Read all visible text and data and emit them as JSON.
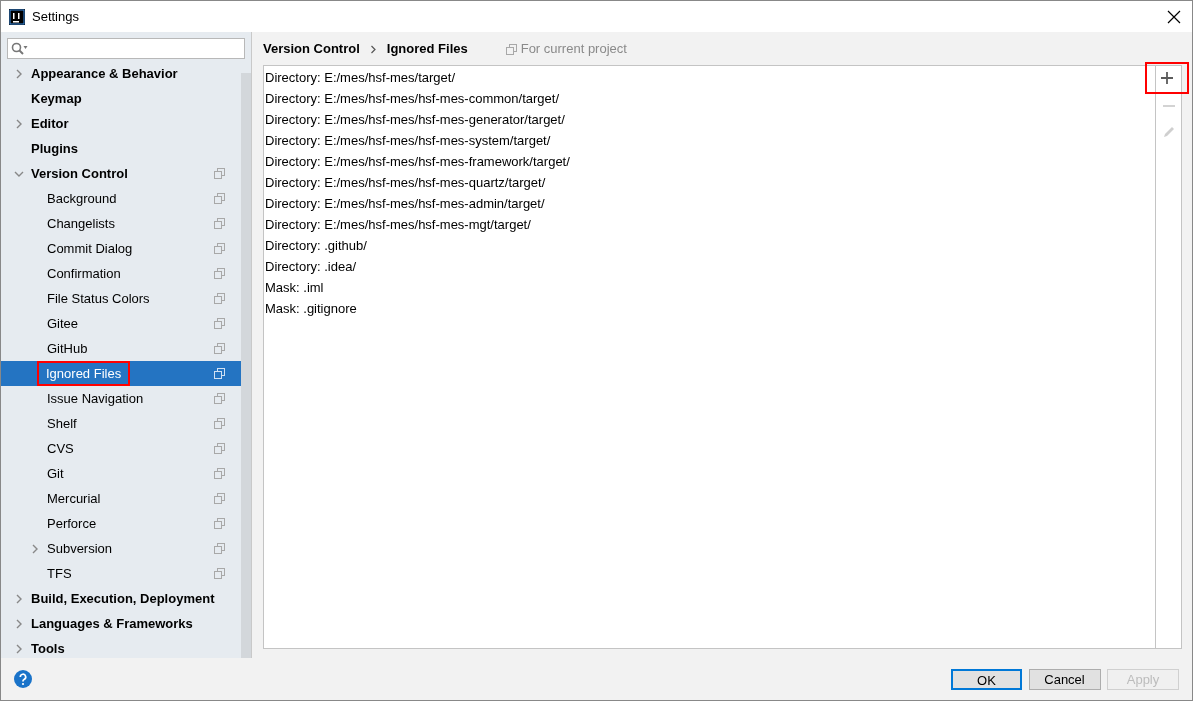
{
  "window": {
    "title": "Settings"
  },
  "sidebar": {
    "items": [
      {
        "label": "Appearance & Behavior",
        "expanded": false,
        "project_level": false,
        "selected": false,
        "annotated": false
      },
      {
        "label": "Keymap",
        "project_level": false,
        "selected": false,
        "annotated": false
      },
      {
        "label": "Editor",
        "expanded": false,
        "project_level": false,
        "selected": false,
        "annotated": false
      },
      {
        "label": "Plugins",
        "project_level": false,
        "selected": false,
        "annotated": false
      },
      {
        "label": "Version Control",
        "expanded": true,
        "project_level": true,
        "selected": false,
        "annotated": false,
        "children": [
          {
            "label": "Background",
            "project_level": true,
            "selected": false,
            "annotated": false
          },
          {
            "label": "Changelists",
            "project_level": true,
            "selected": false,
            "annotated": false
          },
          {
            "label": "Commit Dialog",
            "project_level": true,
            "selected": false,
            "annotated": false
          },
          {
            "label": "Confirmation",
            "project_level": true,
            "selected": false,
            "annotated": false
          },
          {
            "label": "File Status Colors",
            "project_level": true,
            "selected": false,
            "annotated": false
          },
          {
            "label": "Gitee",
            "project_level": true,
            "selected": false,
            "annotated": false
          },
          {
            "label": "GitHub",
            "project_level": true,
            "selected": false,
            "annotated": false
          },
          {
            "label": "Ignored Files",
            "project_level": true,
            "selected": true,
            "annotated": true
          },
          {
            "label": "Issue Navigation",
            "project_level": true,
            "selected": false,
            "annotated": false
          },
          {
            "label": "Shelf",
            "project_level": true,
            "selected": false,
            "annotated": false
          },
          {
            "label": "CVS",
            "project_level": true,
            "selected": false,
            "annotated": false
          },
          {
            "label": "Git",
            "project_level": true,
            "selected": false,
            "annotated": false
          },
          {
            "label": "Mercurial",
            "project_level": true,
            "selected": false,
            "annotated": false
          },
          {
            "label": "Perforce",
            "project_level": true,
            "selected": false,
            "annotated": false
          },
          {
            "label": "Subversion",
            "expanded": false,
            "project_level": true,
            "selected": false,
            "annotated": false
          },
          {
            "label": "TFS",
            "project_level": true,
            "selected": false,
            "annotated": false
          }
        ]
      },
      {
        "label": "Build, Execution, Deployment",
        "expanded": false,
        "project_level": false,
        "selected": false,
        "annotated": false
      },
      {
        "label": "Languages & Frameworks",
        "expanded": false,
        "project_level": false,
        "selected": false,
        "annotated": false
      },
      {
        "label": "Tools",
        "expanded": false,
        "project_level": false,
        "selected": false,
        "annotated": false
      }
    ]
  },
  "breadcrumb": [
    "Version Control",
    "Ignored Files"
  ],
  "scope_note": "For current project",
  "ignored_files": [
    "Directory: E:/mes/hsf-mes/target/",
    "Directory: E:/mes/hsf-mes/hsf-mes-common/target/",
    "Directory: E:/mes/hsf-mes/hsf-mes-generator/target/",
    "Directory: E:/mes/hsf-mes/hsf-mes-system/target/",
    "Directory: E:/mes/hsf-mes/hsf-mes-framework/target/",
    "Directory: E:/mes/hsf-mes/hsf-mes-quartz/target/",
    "Directory: E:/mes/hsf-mes/hsf-mes-admin/target/",
    "Directory: E:/mes/hsf-mes/hsf-mes-mgt/target/",
    "Directory: .github/",
    "Directory: .idea/",
    "Mask: .iml",
    "Mask: .gitignore"
  ],
  "toolbar": [
    {
      "kind": "add",
      "disabled": false,
      "annotated": true
    },
    {
      "kind": "remove",
      "disabled": true,
      "annotated": false
    },
    {
      "kind": "edit",
      "disabled": true,
      "annotated": false
    }
  ],
  "buttons": [
    {
      "label": "OK",
      "default": true,
      "disabled": false
    },
    {
      "label": "Cancel",
      "default": false,
      "disabled": false
    },
    {
      "label": "Apply",
      "default": false,
      "disabled": true
    }
  ]
}
